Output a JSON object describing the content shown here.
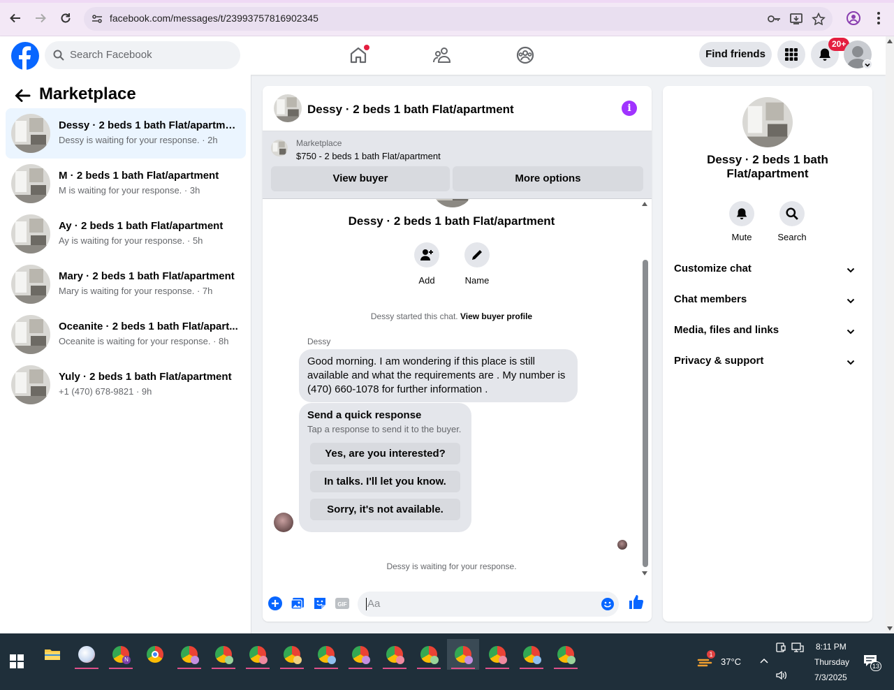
{
  "browser": {
    "url": "facebook.com/messages/t/23993757816902345"
  },
  "header": {
    "search_placeholder": "Search Facebook",
    "find_friends_label": "Find friends",
    "notification_badge": "20+"
  },
  "sidebar": {
    "title": "Marketplace",
    "conversations": [
      {
        "name": "Dessy · 2 beds 1 bath Flat/apartment",
        "subtitle": "Dessy is waiting for your response. · 2h",
        "active": true
      },
      {
        "name": "M · 2 beds 1 bath Flat/apartment",
        "subtitle": "M is waiting for your response. · 3h",
        "active": false
      },
      {
        "name": "Ay · 2 beds 1 bath Flat/apartment",
        "subtitle": "Ay is waiting for your response. · 5h",
        "active": false
      },
      {
        "name": "Mary · 2 beds 1 bath Flat/apartment",
        "subtitle": "Mary is waiting for your response. · 7h",
        "active": false
      },
      {
        "name": "Oceanite · 2 beds 1 bath Flat/apart...",
        "subtitle": "Oceanite is waiting for your response. · 8h",
        "active": false
      },
      {
        "name": "Yuly · 2 beds 1 bath Flat/apartment",
        "subtitle": "+1 (470) 678-9821 · 9h",
        "active": false
      }
    ]
  },
  "chat": {
    "title": "Dessy · 2 beds 1 bath Flat/apartment",
    "marketplace": {
      "label": "Marketplace",
      "listing": "$750 - 2 beds 1 bath Flat/apartment",
      "view_buyer_label": "View buyer",
      "more_options_label": "More options"
    },
    "intro": {
      "name": "Dessy · 2 beds 1 bath Flat/apartment",
      "add_label": "Add",
      "name_label": "Name"
    },
    "started_text": "Dessy started this chat.",
    "view_buyer_profile": "View buyer profile",
    "sender": "Dessy",
    "message": "Good morning. I am wondering if this place is still available and what the requirements are . My number is (470) 660-1078 for further information .",
    "quick_response": {
      "title": "Send a quick response",
      "subtitle": "Tap a response to send it to the buyer.",
      "options": [
        "Yes, are you interested?",
        "In talks. I'll let you know.",
        "Sorry, it's not available."
      ]
    },
    "waiting_text": "Dessy is waiting for your response.",
    "composer_placeholder": "Aa"
  },
  "details": {
    "name": "Dessy · 2 beds 1 bath Flat/apartment",
    "mute_label": "Mute",
    "search_label": "Search",
    "sections": [
      "Customize chat",
      "Chat members",
      "Media, files and links",
      "Privacy & support"
    ]
  },
  "taskbar": {
    "temperature": "37°C",
    "weather_alert": "1",
    "time": "8:11 PM",
    "day": "Thursday",
    "date": "7/3/2025",
    "notification_count": "13"
  },
  "colors": {
    "fb_blue": "#0866ff",
    "active_convo": "#ebf5ff",
    "info_purple": "#a033ff",
    "badge_red": "#e41e3f"
  }
}
